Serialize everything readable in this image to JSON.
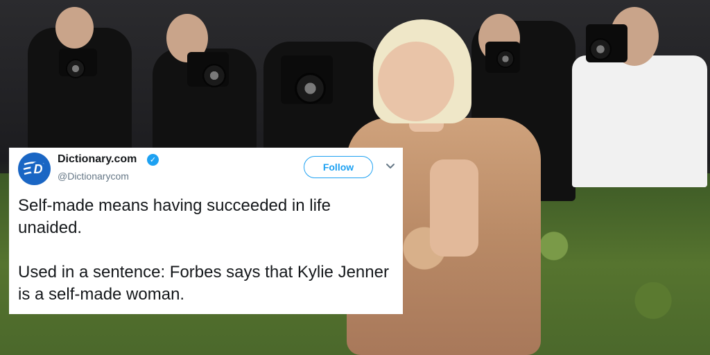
{
  "tweet": {
    "display_name": "Dictionary.com",
    "handle": "@Dictionarycom",
    "follow_label": "Follow",
    "paragraphs": [
      "Self-made means having succeeded in life unaided.",
      "Used in a sentence: Forbes says that Kylie Jenner is a self-made woman."
    ]
  },
  "icons": {
    "avatar": "dictionary-logo-icon",
    "verified": "verified-badge-icon",
    "more": "chevron-down-icon"
  },
  "colors": {
    "accent": "#1da1f2",
    "avatar_bg": "#1a66c4",
    "text": "#14171a",
    "secondary_text": "#657786"
  }
}
